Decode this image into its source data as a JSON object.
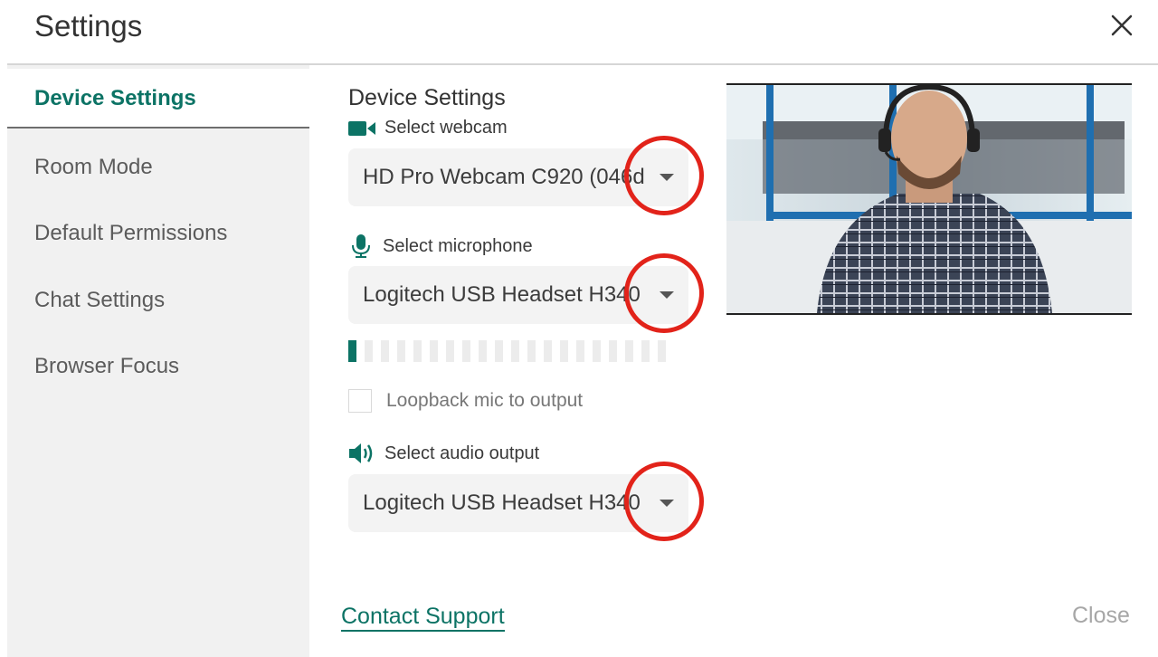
{
  "dialog": {
    "title": "Settings",
    "close_icon": "close-icon"
  },
  "sidebar": {
    "items": [
      {
        "label": "Device Settings",
        "active": true
      },
      {
        "label": "Room Mode",
        "active": false
      },
      {
        "label": "Default Permissions",
        "active": false
      },
      {
        "label": "Chat Settings",
        "active": false
      },
      {
        "label": "Browser Focus",
        "active": false
      }
    ]
  },
  "main": {
    "section_title": "Device Settings",
    "webcam": {
      "label": "Select webcam",
      "icon": "webcam-icon",
      "value": "HD Pro Webcam C920 (046d"
    },
    "microphone": {
      "label": "Select microphone",
      "icon": "microphone-icon",
      "value": "Logitech USB Headset H340",
      "level_segments_total": 20,
      "level_segments_on": 1
    },
    "loopback": {
      "label": "Loopback mic to output",
      "checked": false
    },
    "audio_output": {
      "label": "Select audio output",
      "icon": "speaker-icon",
      "value": "Logitech USB Headset H340"
    }
  },
  "footer": {
    "contact_support": "Contact Support",
    "close": "Close"
  },
  "colors": {
    "accent": "#0c7365",
    "annotation_ring": "#e2231a"
  }
}
